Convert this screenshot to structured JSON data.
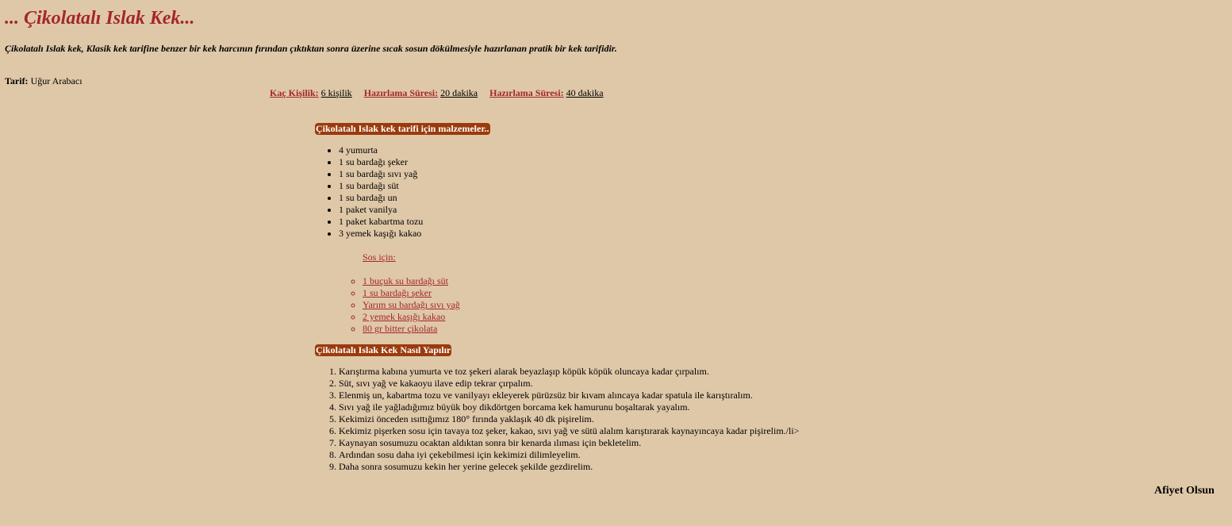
{
  "title": "... Çikolatalı Islak Kek...",
  "intro": "Çikolatalı Islak kek, Klasik kek tarifine benzer bir kek harcının fırından çıktıktan sonra üzerine sıcak sosun dökülmesiyle hazırlanan pratik bir kek tarifidir.",
  "author": {
    "label": "Tarif:",
    "name": "Uğur Arabacı"
  },
  "meta": [
    {
      "label": "Kaç Kişilik:",
      "value": "6 kişilik"
    },
    {
      "label": "Hazırlama Süresi:",
      "value": "20 dakika"
    },
    {
      "label": "Hazırlama Süresi:",
      "value": "40 dakika"
    }
  ],
  "ingredients_heading": "Çikolatalı Islak kek tarifi için malzemeler..",
  "ingredients": [
    "4 yumurta",
    "1 su bardağı şeker",
    "1 su bardağı sıvı yağ",
    "1 su bardağı süt",
    "1 su bardağı un",
    "1 paket vanilya",
    "1 paket kabartma tozu",
    "3 yemek kaşığı kakao"
  ],
  "sauce": {
    "label": "Sos için:",
    "items": [
      "1 buçuk su bardağı süt",
      "1 su bardağı şeker",
      "Yarım su bardağı sıvı yağ",
      "2 yemek kaşığı kakao",
      "80 gr bitter çikolata"
    ]
  },
  "steps_heading": "Çikolatalı Islak Kek Nasıl Yapılır",
  "steps": [
    "Karıştırma kabına yumurta ve toz şekeri alarak beyazlaşıp köpük köpük oluncaya kadar çırpalım.",
    "Süt, sıvı yağ ve kakaoyu ilave edip tekrar çırpalım.",
    "Elenmiş un, kabartma tozu ve vanilyayı ekleyerek pürüzsüz bir kıvam alıncaya kadar spatula ile karıştıralım.",
    "Sıvı yağ ile yağladığımız büyük boy dikdörtgen borcama kek hamurunu boşaltarak yayalım.",
    "Kekimizi önceden ısıttığımız 180° fırında yaklaşık 40 dk pişirelim.",
    "Kekimiz pişerken sosu için tavaya toz şeker, kakao, sıvı yağ ve sütü alalım karıştırarak kaynayıncaya kadar pişirelim./li>",
    "Kaynayan sosumuzu ocaktan aldıktan sonra bir kenarda ılıması için bekletelim.",
    "Ardından sosu daha iyi çekebilmesi için kekimizi dilimleyelim.",
    "Daha sonra sosumuzu kekin her yerine gelecek şekilde gezdirelim."
  ],
  "closing": "Afiyet Olsun",
  "colors": {
    "background": "#dfc8a8",
    "accent": "#a4262c",
    "heading_bg": "#9b3a0c"
  }
}
